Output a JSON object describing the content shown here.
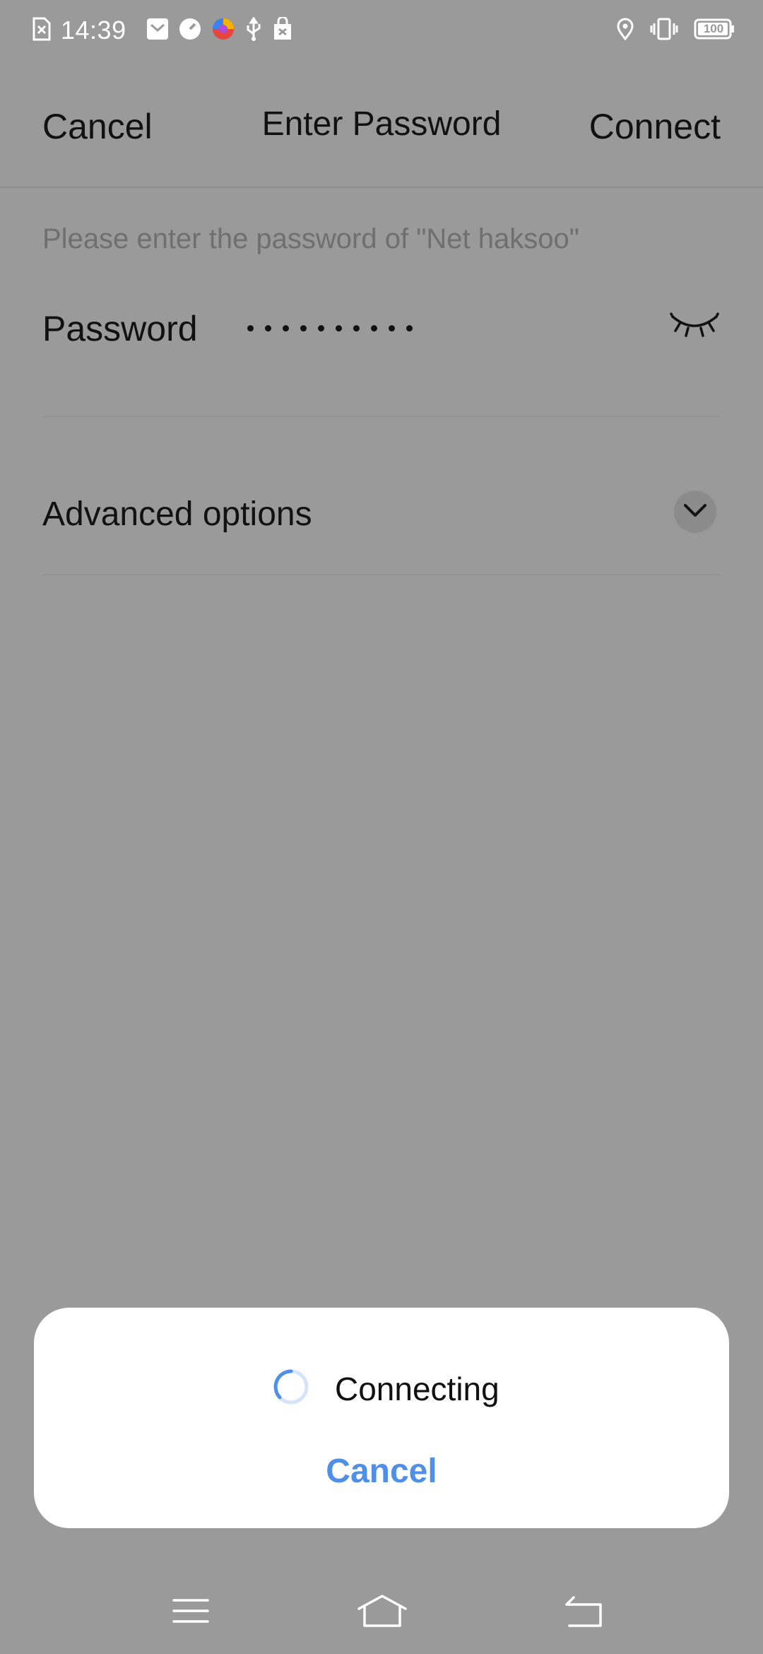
{
  "status_bar": {
    "time": "14:39",
    "battery": "100",
    "icons": [
      "sim-error-icon",
      "mail-icon",
      "speedometer-icon",
      "browser-icon",
      "usb-icon",
      "store-icon",
      "location-icon",
      "vibrate-icon",
      "battery-icon"
    ]
  },
  "header": {
    "cancel_label": "Cancel",
    "title": "Enter Password",
    "connect_label": "Connect"
  },
  "form": {
    "hint": "Please enter the password of \"Net haksoo\"",
    "password_label": "Password",
    "password_masked_length": 10,
    "advanced_label": "Advanced options"
  },
  "dialog": {
    "status": "Connecting",
    "cancel_label": "Cancel",
    "accent": "#4f8fe8"
  },
  "navbar": {
    "icons": [
      "menu-icon",
      "home-icon",
      "back-icon"
    ]
  },
  "colors": {
    "overlay_background": "#9a9a9a",
    "dialog_background": "#ffffff"
  }
}
